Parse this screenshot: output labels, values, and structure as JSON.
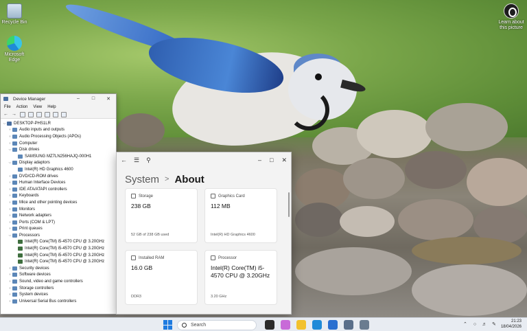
{
  "desktop": {
    "icons": [
      {
        "label": "Recycle Bin",
        "icon": "recycle-bin-icon"
      },
      {
        "label": "Microsoft Edge",
        "icon": "edge-icon"
      },
      {
        "label": "Learn about this picture",
        "icon": "camera-info-icon"
      }
    ]
  },
  "device_manager": {
    "title": "Device Manager",
    "menu": [
      "File",
      "Action",
      "View",
      "Help"
    ],
    "tree": [
      {
        "label": "DESKTOP-PHS1LR",
        "level": 0,
        "expanded": true,
        "icon": "computer-icon"
      },
      {
        "label": "Audio inputs and outputs",
        "level": 1,
        "expanded": false
      },
      {
        "label": "Audio Processing Objects (APOs)",
        "level": 1,
        "expanded": false
      },
      {
        "label": "Computer",
        "level": 1,
        "expanded": false
      },
      {
        "label": "Disk drives",
        "level": 1,
        "expanded": true
      },
      {
        "label": "SAMSUNG MZ7LN256HAJQ-000H1",
        "level": 2
      },
      {
        "label": "Display adaptors",
        "level": 1,
        "expanded": true
      },
      {
        "label": "Intel(R) HD Graphics 4600",
        "level": 2
      },
      {
        "label": "DVD/CD-ROM drives",
        "level": 1,
        "expanded": false
      },
      {
        "label": "Human Interface Devices",
        "level": 1,
        "expanded": false
      },
      {
        "label": "IDE ATA/ATAPI controllers",
        "level": 1,
        "expanded": false
      },
      {
        "label": "Keyboards",
        "level": 1,
        "expanded": false
      },
      {
        "label": "Mice and other pointing devices",
        "level": 1,
        "expanded": false
      },
      {
        "label": "Monitors",
        "level": 1,
        "expanded": false
      },
      {
        "label": "Network adapters",
        "level": 1,
        "expanded": false
      },
      {
        "label": "Ports (COM & LPT)",
        "level": 1,
        "expanded": false
      },
      {
        "label": "Print queues",
        "level": 1,
        "expanded": false
      },
      {
        "label": "Processors",
        "level": 1,
        "expanded": true
      },
      {
        "label": "Intel(R) Core(TM) i5-4570 CPU @ 3.20GHz",
        "level": 2,
        "cpu": true
      },
      {
        "label": "Intel(R) Core(TM) i5-4570 CPU @ 3.20GHz",
        "level": 2,
        "cpu": true
      },
      {
        "label": "Intel(R) Core(TM) i5-4570 CPU @ 3.20GHz",
        "level": 2,
        "cpu": true
      },
      {
        "label": "Intel(R) Core(TM) i5-4570 CPU @ 3.20GHz",
        "level": 2,
        "cpu": true
      },
      {
        "label": "Security devices",
        "level": 1,
        "expanded": false
      },
      {
        "label": "Software devices",
        "level": 1,
        "expanded": false
      },
      {
        "label": "Sound, video and game controllers",
        "level": 1,
        "expanded": false
      },
      {
        "label": "Storage controllers",
        "level": 1,
        "expanded": false
      },
      {
        "label": "System devices",
        "level": 1,
        "expanded": false
      },
      {
        "label": "Universal Serial Bus controllers",
        "level": 1,
        "expanded": false
      }
    ]
  },
  "settings": {
    "breadcrumb_parent": "System",
    "breadcrumb_sep": ">",
    "page_title": "About",
    "cards": [
      {
        "label": "Storage",
        "value": "238 GB",
        "sub": "52 GB of 238 GB used",
        "icon": "storage-icon"
      },
      {
        "label": "Graphics Card",
        "value": "112 MB",
        "sub": "Intel(R) HD Graphics 4600",
        "icon": "graphics-card-icon"
      },
      {
        "label": "Installed RAM",
        "value": "16.0 GB",
        "sub": "DDR3",
        "icon": "ram-icon"
      },
      {
        "label": "Processor",
        "value": "Intel(R) Core(TM) i5-4570 CPU @ 3.20GHz",
        "sub": "3.20 GHz",
        "icon": "processor-icon"
      }
    ]
  },
  "taskbar": {
    "search_placeholder": "Search",
    "time": "21:23",
    "date": "18/04/2026",
    "apps": [
      {
        "name": "task-view",
        "color": "#2b2b2b"
      },
      {
        "name": "copilot",
        "color": "#c86ad8"
      },
      {
        "name": "file-explorer",
        "color": "#f2c12e"
      },
      {
        "name": "edge",
        "color": "#1f8ad8"
      },
      {
        "name": "store",
        "color": "#2a6fd0"
      },
      {
        "name": "settings",
        "color": "#5a6f8a"
      },
      {
        "name": "device-manager",
        "color": "#6a7c90"
      }
    ]
  }
}
